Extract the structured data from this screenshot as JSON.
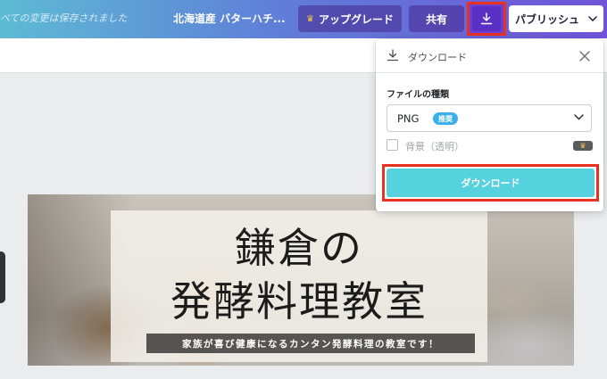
{
  "topbar": {
    "save_status": "べての変更は保存されました",
    "doc_title": "北海道産 バターハチ...",
    "upgrade_label": "アップグレード",
    "share_label": "共有",
    "publish_label": "パブリッシュ"
  },
  "design": {
    "title_line1": "鎌倉の",
    "title_line2": "発酵料理教室",
    "subtitle": "家族が喜び健康になるカンタン発酵料理の教室です！"
  },
  "download_panel": {
    "header_title": "ダウンロード",
    "file_type_label": "ファイルの種類",
    "file_type_value": "PNG",
    "recommended_badge": "推奨",
    "transparent_bg_label": "背景（透明）",
    "download_button_label": "ダウンロード"
  },
  "colors": {
    "topbar_gradient_start": "#5dbbd4",
    "topbar_gradient_end": "#7053d8",
    "download_button": "#56d2de",
    "highlight_frame": "#e8311f",
    "badge_blue": "#3ab0ea"
  },
  "icons": {
    "crown": "crown-icon",
    "download": "download-icon",
    "chevron": "chevron-down-icon",
    "close": "close-icon"
  }
}
